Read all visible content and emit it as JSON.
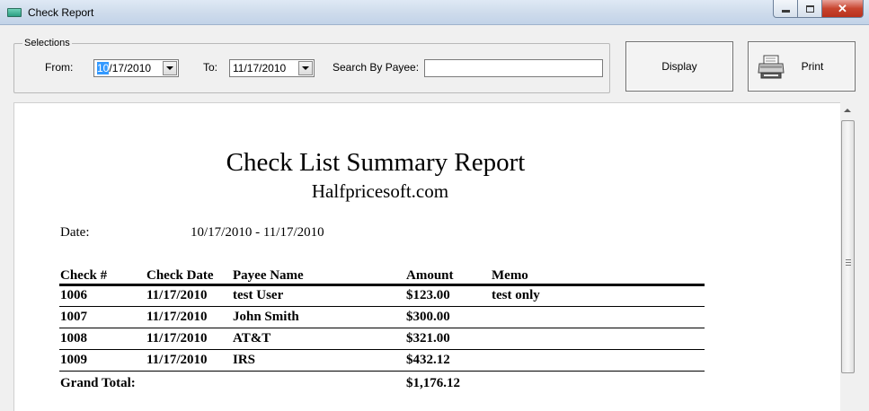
{
  "window": {
    "title": "Check Report"
  },
  "selections": {
    "legend": "Selections",
    "from_label": "From:",
    "from_value_selected": "10",
    "from_value_rest": "/17/2010",
    "to_label": "To:",
    "to_value": "11/17/2010",
    "payee_label": "Search By Payee:",
    "payee_value": ""
  },
  "buttons": {
    "display": "Display",
    "print": "Print"
  },
  "report": {
    "title": "Check List Summary Report",
    "company": "Halfpricesoft.com",
    "date_label": "Date:",
    "date_range": "10/17/2010 - 11/17/2010",
    "columns": [
      "Check #",
      "Check Date",
      "Payee Name",
      "Amount",
      "Memo"
    ],
    "rows": [
      [
        "1006",
        "11/17/2010",
        "test User",
        "$123.00",
        "test only"
      ],
      [
        "1007",
        "11/17/2010",
        "John Smith",
        "$300.00",
        ""
      ],
      [
        "1008",
        "11/17/2010",
        "AT&T",
        "$321.00",
        ""
      ],
      [
        "1009",
        "11/17/2010",
        "IRS",
        "$432.12",
        ""
      ]
    ],
    "grand_total_label": "Grand Total:",
    "grand_total_value": "$1,176.12"
  }
}
